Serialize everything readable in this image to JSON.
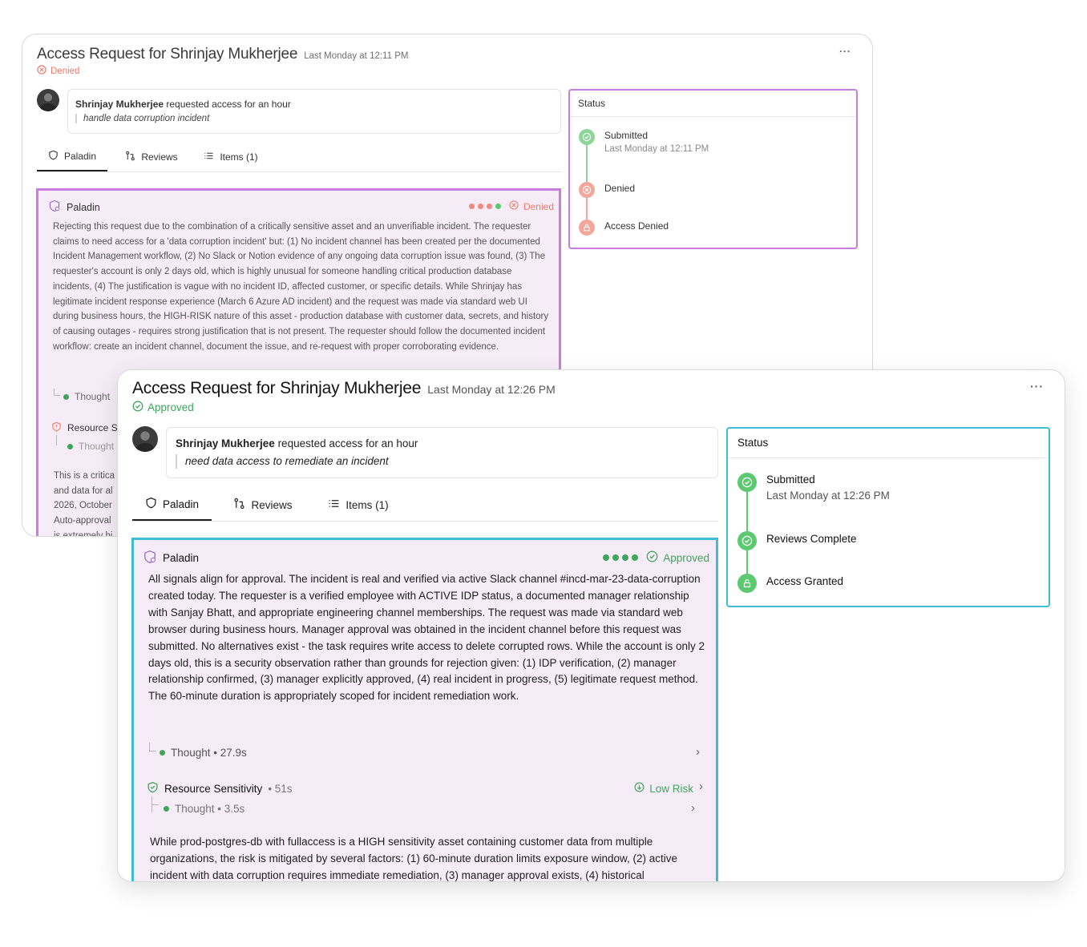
{
  "colors": {
    "denied": "#ef7b6c",
    "approved": "#3ea55b",
    "back_highlight": "#c77ee0",
    "front_highlight": "#40bdd6",
    "paladin_bg": "#f6ecf7",
    "step_green": "#5cc970",
    "step_red": "#f08a80"
  },
  "back": {
    "title": "Access Request for Shrinjay Mukherjee",
    "timestamp": "Last Monday at 12:11 PM",
    "status": "Denied",
    "more": "···",
    "request": {
      "requester": "Shrinjay Mukherjee",
      "action": "requested access for an hour",
      "reason": "handle data corruption incident"
    },
    "tabs": [
      {
        "label": "Paladin",
        "icon": "paladin-icon"
      },
      {
        "label": "Reviews",
        "icon": "git-compare-icon"
      },
      {
        "label": "Items (1)",
        "icon": "list-icon"
      }
    ],
    "status_panel": {
      "heading": "Status",
      "steps": [
        {
          "label": "Submitted",
          "sub": "Last Monday at 12:11 PM",
          "icon": "check-circle-icon"
        },
        {
          "label": "Denied",
          "icon": "x-circle-icon"
        },
        {
          "label": "Access Denied",
          "icon": "lock-icon"
        }
      ]
    },
    "paladin": {
      "title": "Paladin",
      "verdict": "Denied",
      "text": "Rejecting this request due to the combination of a critically sensitive asset and an unverifiable incident. The requester claims to need access for a 'data corruption incident' but: (1) No incident channel has been created per the documented Incident Management workflow, (2) No Slack or Notion evidence of any ongoing data corruption issue was found, (3) The requester's account is only 2 days old, which is highly unusual for someone handling critical production database incidents, (4) The justification is vague with no incident ID, affected customer, or specific details. While Shrinjay has legitimate incident response experience (March 6 Azure AD incident) and the request was made via standard web UI during business hours, the HIGH-RISK nature of this asset - production database with customer data, secrets, and history of causing outages - requires strong justification that is not present. The requester should follow the documented incident workflow: create an incident channel, document the issue, and re-request with proper corroborating evidence.",
      "thought": "Thought",
      "resource_label": "Resource S",
      "thought2": "Thought",
      "body_lines": [
        "This is a critica",
        "and data for al",
        "2026, October",
        "Auto-approval",
        "is extremely hi"
      ]
    }
  },
  "front": {
    "title": "Access Request for Shrinjay Mukherjee",
    "timestamp": "Last Monday at 12:26 PM",
    "status": "Approved",
    "more": "···",
    "request": {
      "requester": "Shrinjay Mukherjee",
      "action": "requested access for an hour",
      "reason": "need data access to remediate an incident"
    },
    "tabs": [
      {
        "label": "Paladin",
        "icon": "paladin-icon"
      },
      {
        "label": "Reviews",
        "icon": "git-compare-icon"
      },
      {
        "label": "Items (1)",
        "icon": "list-icon"
      }
    ],
    "status_panel": {
      "heading": "Status",
      "steps": [
        {
          "label": "Submitted",
          "sub": "Last Monday at 12:26 PM",
          "icon": "check-circle-icon"
        },
        {
          "label": "Reviews Complete",
          "icon": "check-circle-icon"
        },
        {
          "label": "Access Granted",
          "icon": "unlock-icon"
        }
      ]
    },
    "paladin": {
      "title": "Paladin",
      "verdict": "Approved",
      "text": "All signals align for approval. The incident is real and verified via active Slack channel #incd-mar-23-data-corruption created today. The requester is a verified employee with ACTIVE IDP status, a documented manager relationship with Sanjay Bhatt, and appropriate engineering channel memberships. The request was made via standard web browser during business hours. Manager approval was obtained in the incident channel before this request was submitted. No alternatives exist - the task requires write access to delete corrupted rows. While the account is only 2 days old, this is a security observation rather than grounds for rejection given: (1) IDP verification, (2) manager relationship confirmed, (3) manager explicitly approved, (4) real incident in progress, (5) legitimate request method. The 60-minute duration is appropriately scoped for incident remediation work.",
      "thought": "Thought • 27.9s",
      "resource": {
        "label": "Resource Sensitivity",
        "duration": "• 51s",
        "risk": "Low Risk",
        "thought": "Thought • 3.5s"
      },
      "resource_text": "While prod-postgres-db with fullaccess is a HIGH sensitivity asset containing customer data from multiple organizations, the risk is mitigated by several factors: (1) 60-minute duration limits exposure window, (2) active incident with data corruption requires immediate remediation, (3) manager approval exists, (4) historical"
    }
  }
}
